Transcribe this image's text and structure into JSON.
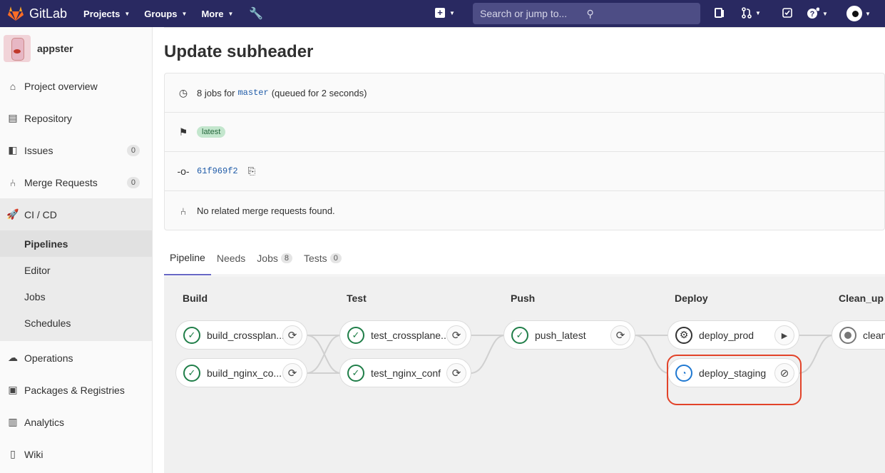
{
  "topnav": {
    "brand": "GitLab",
    "links": [
      "Projects",
      "Groups",
      "More"
    ],
    "search_placeholder": "Search or jump to..."
  },
  "sidebar": {
    "project_name": "appster",
    "items": [
      {
        "label": "Project overview",
        "icon": "home-icon"
      },
      {
        "label": "Repository",
        "icon": "doc-icon"
      },
      {
        "label": "Issues",
        "icon": "issues-icon",
        "count": "0"
      },
      {
        "label": "Merge Requests",
        "icon": "merge-request-icon",
        "count": "0"
      },
      {
        "label": "CI / CD",
        "icon": "rocket-icon"
      },
      {
        "label": "Operations",
        "icon": "cloud-gear-icon"
      },
      {
        "label": "Packages & Registries",
        "icon": "package-icon"
      },
      {
        "label": "Analytics",
        "icon": "chart-icon"
      },
      {
        "label": "Wiki",
        "icon": "book-icon"
      }
    ],
    "subitems": [
      "Pipelines",
      "Editor",
      "Jobs",
      "Schedules"
    ]
  },
  "page": {
    "title": "Update subheader",
    "info": {
      "jobs_prefix": "8 jobs for",
      "branch": "master",
      "jobs_suffix": "(queued for 2 seconds)",
      "badge": "latest",
      "commit": "61f969f2",
      "merge_requests": "No related merge requests found."
    }
  },
  "tabs": [
    {
      "label": "Pipeline"
    },
    {
      "label": "Needs"
    },
    {
      "label": "Jobs",
      "count": "8"
    },
    {
      "label": "Tests",
      "count": "0"
    }
  ],
  "stages": [
    {
      "title": "Build",
      "jobs": [
        {
          "name": "build_crossplane_objects",
          "display": "build_crossplan...",
          "status": "passed",
          "action": "retry"
        },
        {
          "name": "build_nginx_conf",
          "display": "build_nginx_co...",
          "status": "passed",
          "action": "retry"
        }
      ]
    },
    {
      "title": "Test",
      "jobs": [
        {
          "name": "test_crossplane_objects",
          "display": "test_crossplane...",
          "status": "passed",
          "action": "retry"
        },
        {
          "name": "test_nginx_conf",
          "display": "test_nginx_conf",
          "status": "passed",
          "action": "retry"
        }
      ]
    },
    {
      "title": "Push",
      "jobs": [
        {
          "name": "push_latest",
          "display": "push_latest",
          "status": "passed",
          "action": "retry"
        }
      ]
    },
    {
      "title": "Deploy",
      "jobs": [
        {
          "name": "deploy_prod",
          "display": "deploy_prod",
          "status": "manual",
          "action": "play"
        },
        {
          "name": "deploy_staging",
          "display": "deploy_staging",
          "status": "pending",
          "action": "cancel"
        }
      ]
    },
    {
      "title": "Clean_up",
      "jobs": [
        {
          "name": "cleanup",
          "display": "clean",
          "status": "created",
          "action": ""
        }
      ]
    }
  ],
  "colors": {
    "nav": "#292961",
    "success": "#1f7e48",
    "pending": "#1f78d1",
    "highlight": "#e24329"
  }
}
